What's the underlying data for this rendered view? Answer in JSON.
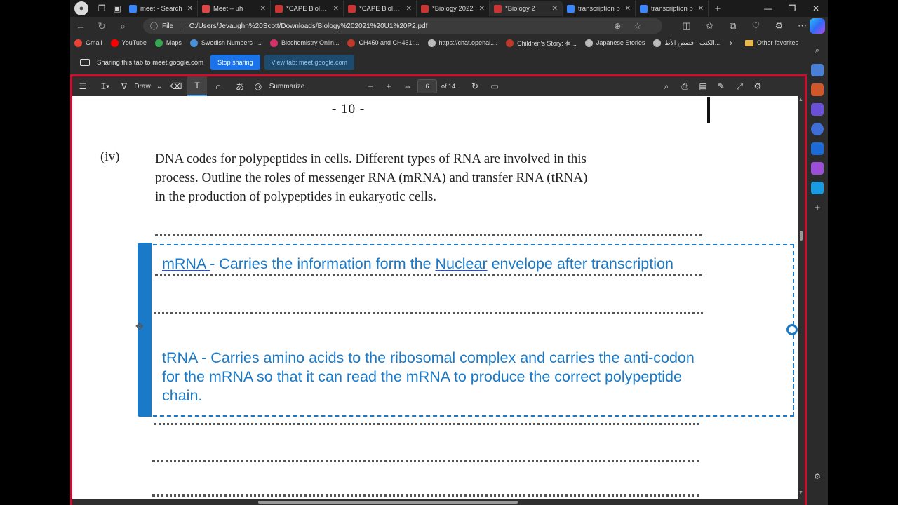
{
  "tabs": [
    {
      "title": "meet - Search",
      "color": "#3a86ff"
    },
    {
      "title": "Meet – uh",
      "color": "#e04646"
    },
    {
      "title": "*CAPE Biology",
      "color": "#c33"
    },
    {
      "title": "*CAPE Biology",
      "color": "#c33"
    },
    {
      "title": "*Biology 2022",
      "color": "#c33"
    },
    {
      "title": "*Biology 2",
      "color": "#c33"
    },
    {
      "title": "transcription p",
      "color": "#3a86ff"
    },
    {
      "title": "transcription p",
      "color": "#3a86ff"
    }
  ],
  "address": {
    "file_label": "File",
    "url": "C:/Users/Jevaughn%20Scott/Downloads/Biology%202021%20U1%20P2.pdf"
  },
  "favorites": [
    {
      "label": "Gmail",
      "color": "#ea4335"
    },
    {
      "label": "YouTube",
      "color": "#ff0000"
    },
    {
      "label": "Maps",
      "color": "#34a853"
    },
    {
      "label": "Swedish Numbers -...",
      "color": "#4a90d9"
    },
    {
      "label": "Biochemistry Onlin...",
      "color": "#d6336c"
    },
    {
      "label": "CH450 and CH451:...",
      "color": "#c0392b"
    },
    {
      "label": "https://chat.openai....",
      "color": "#bbbbbb"
    },
    {
      "label": "Children's Story: 有...",
      "color": "#c0392b"
    },
    {
      "label": "Japanese Stories",
      "color": "#bbbbbb"
    },
    {
      "label": "الكتب - قصص الأط...",
      "color": "#bbbbbb"
    }
  ],
  "other_favorites": "Other favorites",
  "sharing": {
    "text": "Sharing this tab to meet.google.com",
    "stop": "Stop sharing",
    "view": "View tab: meet.google.com"
  },
  "pdf_toolbar": {
    "draw": "Draw",
    "summarize": "Summarize",
    "page": "6",
    "of": "of 14"
  },
  "page_content": {
    "page_number": "- 10 -",
    "question_num": "(iv)",
    "question_lines": [
      "DNA codes for polypeptides in cells.  Different types of RNA are involved in this",
      "process.  Outline the roles of messenger RNA (mRNA) and transfer RNA (tRNA)",
      "in the production of polypeptides in eukaryotic cells."
    ]
  },
  "annotation": {
    "mrna_term": "mRNA ",
    "mrna_text_a": " - Carries the information form the ",
    "mrna_nuclear": "Nuclear",
    "mrna_text_b": " envelope after transcription",
    "trna_line1": "tRNA - Carries amino acids to the ribosomal complex and carries the anti-codon",
    "trna_line2": "for the mRNA so that it can read the mRNA to produce the correct polypeptide",
    "trna_line3": "chain."
  }
}
